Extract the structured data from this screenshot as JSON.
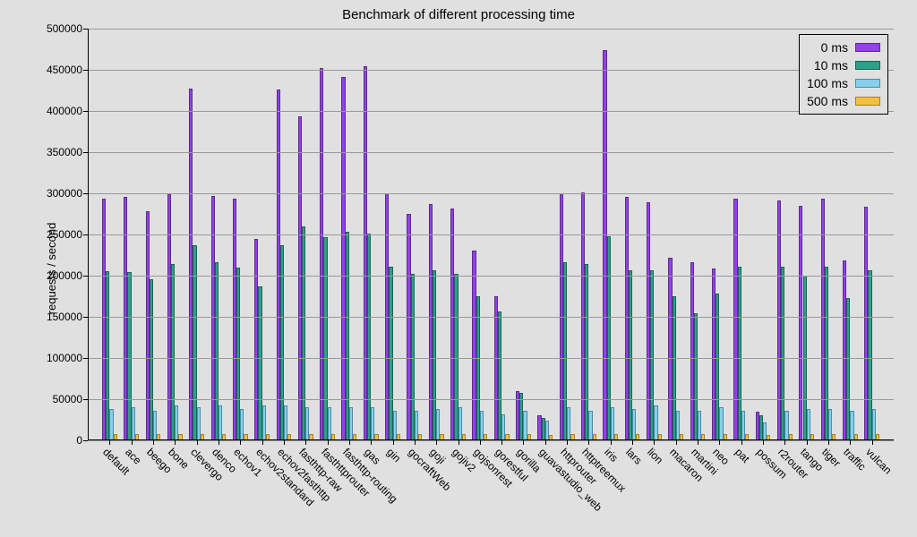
{
  "chart_data": {
    "type": "bar",
    "title": "Benchmark of different processing time",
    "ylabel": "requests / second",
    "xlabel": "",
    "ylim": [
      0,
      500000
    ],
    "yticks": [
      0,
      50000,
      100000,
      150000,
      200000,
      250000,
      300000,
      350000,
      400000,
      450000,
      500000
    ],
    "categories": [
      "default",
      "ace",
      "beego",
      "bone",
      "clevergo",
      "denco",
      "echov1",
      "echov2standard",
      "echov2fasthttp",
      "fasthttp-raw",
      "fasthttprouter",
      "fasthttp-routing",
      "gas",
      "gin",
      "gocraftWeb",
      "goji",
      "gojiv2",
      "gojsonrest",
      "gorestful",
      "gorilla",
      "guavastudio_web",
      "httprouter",
      "httptreemux",
      "iris",
      "lars",
      "lion",
      "macaron",
      "martini",
      "neo",
      "pat",
      "possum",
      "r2router",
      "tango",
      "tiger",
      "traffic",
      "vulcan"
    ],
    "series": [
      {
        "name": "0 ms",
        "color": "#9440ed",
        "values": [
          294000,
          296000,
          278000,
          299000,
          427000,
          297000,
          294000,
          245000,
          426000,
          394000,
          452000,
          441000,
          454000,
          300000,
          275000,
          287000,
          282000,
          230000,
          175000,
          60000,
          30000,
          300000,
          301000,
          474000,
          296000,
          289000,
          222000,
          216000,
          209000,
          294000,
          35000,
          291000,
          285000,
          293000,
          218000,
          284000
        ]
      },
      {
        "name": "10 ms",
        "color": "#2ca089",
        "values": [
          205000,
          204000,
          196000,
          214000,
          237000,
          216000,
          210000,
          187000,
          237000,
          260000,
          247000,
          253000,
          251000,
          211000,
          202000,
          206000,
          202000,
          175000,
          156000,
          58000,
          27000,
          216000,
          214000,
          248000,
          206000,
          206000,
          175000,
          154000,
          178000,
          211000,
          30000,
          211000,
          200000,
          211000,
          173000,
          206000
        ]
      },
      {
        "name": "100 ms",
        "color": "#87cfeb",
        "values": [
          38000,
          40000,
          36000,
          42000,
          40000,
          42000,
          38000,
          42000,
          42000,
          40000,
          40000,
          40000,
          40000,
          36000,
          36000,
          38000,
          40000,
          36000,
          32000,
          36000,
          24000,
          40000,
          36000,
          40000,
          38000,
          42000,
          36000,
          36000,
          40000,
          36000,
          22000,
          36000,
          38000,
          38000,
          36000,
          38000
        ]
      },
      {
        "name": "500 ms",
        "color": "#f0c040",
        "values": [
          8000,
          8000,
          8000,
          8000,
          8000,
          8000,
          8000,
          8000,
          8000,
          8000,
          8000,
          8000,
          8000,
          8000,
          8000,
          8000,
          8000,
          8000,
          8000,
          8000,
          6000,
          8000,
          8000,
          8000,
          8000,
          8000,
          8000,
          8000,
          8000,
          8000,
          6000,
          8000,
          8000,
          8000,
          8000,
          8000
        ]
      }
    ],
    "legend_position": "top-right",
    "grid": "horizontal"
  }
}
